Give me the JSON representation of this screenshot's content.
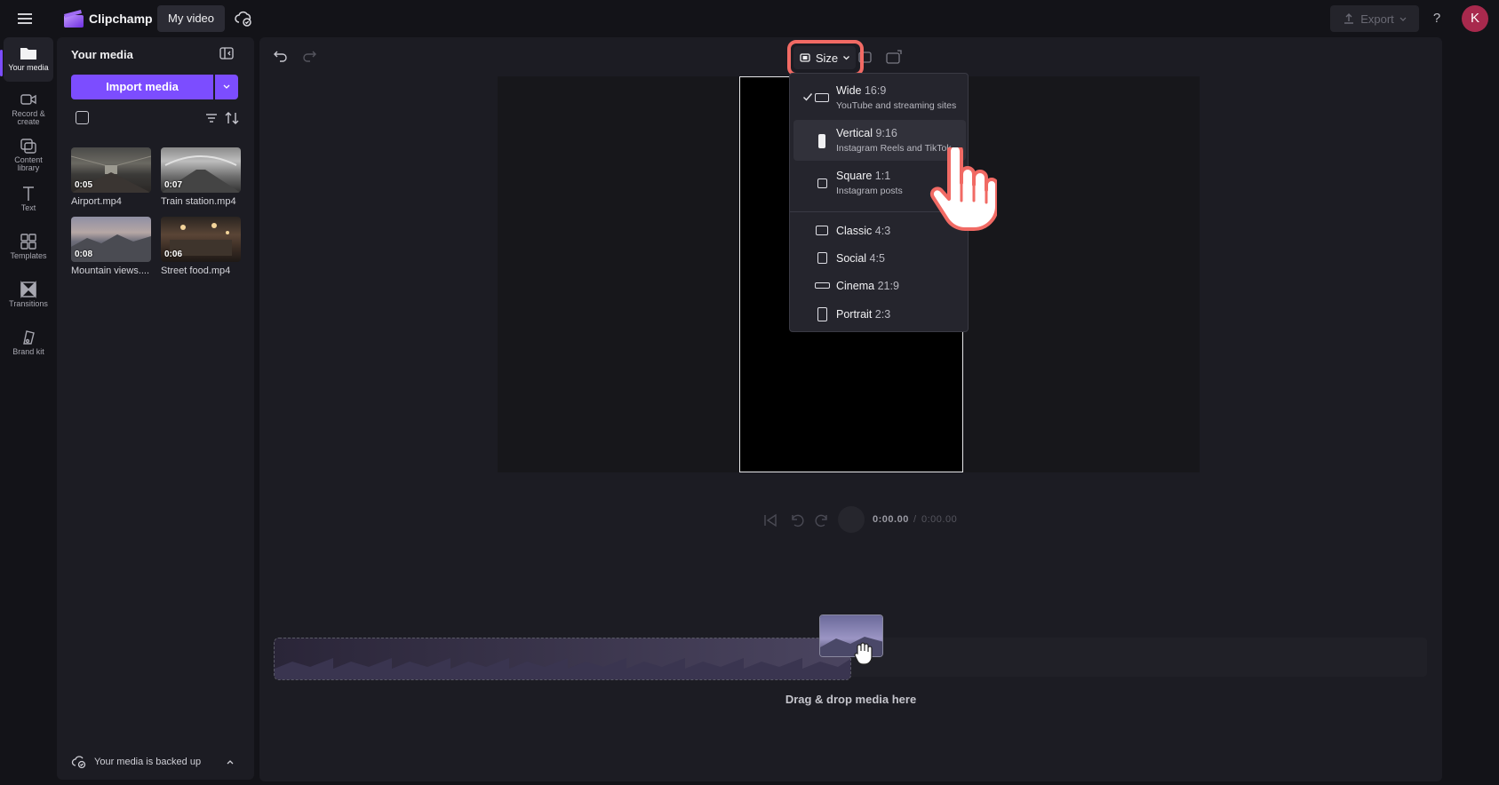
{
  "app": {
    "name": "Clipchamp",
    "project_title": "My video",
    "avatar_initial": "K",
    "accent_color": "#7c4dff",
    "highlight_color": "#f16a64"
  },
  "topbar": {
    "export_label": "Export",
    "help_glyph": "?"
  },
  "nav": {
    "items": [
      {
        "label": "Your media",
        "icon": "folder-icon"
      },
      {
        "label": "Record & create",
        "icon": "camera-icon"
      },
      {
        "label": "Content library",
        "icon": "library-icon"
      },
      {
        "label": "Text",
        "icon": "text-icon"
      },
      {
        "label": "Templates",
        "icon": "templates-icon"
      },
      {
        "label": "Transitions",
        "icon": "transitions-icon"
      },
      {
        "label": "Brand kit",
        "icon": "brand-kit-icon"
      }
    ]
  },
  "media": {
    "title": "Your media",
    "import_label": "Import media",
    "items": [
      {
        "name": "Airport.mp4",
        "duration": "0:05"
      },
      {
        "name": "Train station.mp4",
        "duration": "0:07"
      },
      {
        "name": "Mountain views....",
        "duration": "0:08"
      },
      {
        "name": "Street food.mp4",
        "duration": "0:06"
      }
    ],
    "backup_text": "Your media is backed up"
  },
  "size_menu": {
    "button_label": "Size",
    "options": [
      {
        "label": "Wide",
        "ratio": "16:9",
        "desc": "YouTube and streaming sites",
        "checked": true
      },
      {
        "label": "Vertical",
        "ratio": "9:16",
        "desc": "Instagram Reels and TikTok",
        "hovered": true
      },
      {
        "label": "Square",
        "ratio": "1:1",
        "desc": "Instagram posts"
      },
      {
        "label": "Classic",
        "ratio": "4:3"
      },
      {
        "label": "Social",
        "ratio": "4:5"
      },
      {
        "label": "Cinema",
        "ratio": "21:9"
      },
      {
        "label": "Portrait",
        "ratio": "2:3"
      }
    ]
  },
  "playback": {
    "current_time": "0:00.00",
    "separator": "/",
    "total_time": "0:00.00"
  },
  "timeline": {
    "drop_text": "Drag & drop media here"
  }
}
